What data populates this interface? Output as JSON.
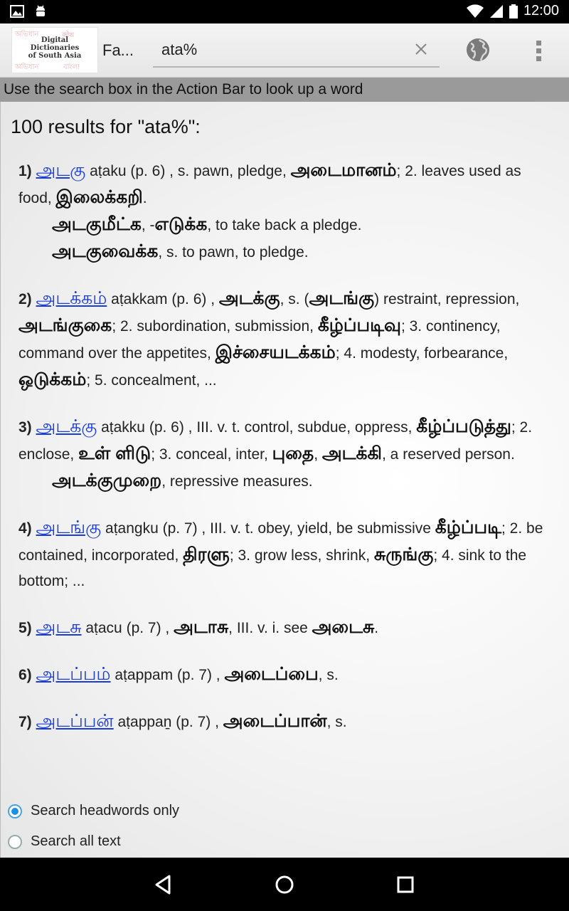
{
  "status_bar": {
    "time": "12:00",
    "icons": [
      "image-icon",
      "android-icon",
      "wifi-icon",
      "signal-icon",
      "battery-icon"
    ]
  },
  "action_bar": {
    "logo_lines": [
      "Digital",
      "Dictionaries",
      "of South Asia"
    ],
    "logo_script_text": [
      "অভিধান",
      "कोश",
      "অভিধান",
      "বাংলা"
    ],
    "app_title": "Fa...",
    "search_value": "ata%",
    "icons": [
      "close-icon",
      "globe-icon",
      "overflow-menu-icon"
    ]
  },
  "hint": "Use the search box in the Action Bar to look up a word",
  "results_title": "100 results for \"ata%\":",
  "entries": {
    "e1": {
      "num": "1)",
      "head": "அடகு",
      "t1": " aṭaku (p. 6) , s. pawn, pledge, ",
      "ta1": "அடைமானம்",
      "t2": "; 2. leaves used as food, ",
      "ta2": "இலைக்கறி",
      "t3": ".",
      "s1_ta": "அடகுமீட்க",
      "s1_mid": ", -",
      "s1_ta2": "எடுக்க",
      "s1_t": ", to take back a pledge.",
      "s2_ta": "அடகுவைக்க",
      "s2_t": ", s. to pawn, to pledge."
    },
    "e2": {
      "num": "2)",
      "head": "அடக்கம்",
      "t1": " aṭakkam (p. 6) , ",
      "ta1": "அடக்கு",
      "t2": ", s. (",
      "ta2": "அடங்கு",
      "t3": ") restraint, repression, ",
      "ta3": "அடங்குகை",
      "t4": "; 2. subordination, submission, ",
      "ta4": "கீழ்ப்படிவு",
      "t5": "; 3. continency, command over the appetites, ",
      "ta5": "இச்சையடக்கம்",
      "t6": "; 4. modesty, forbearance, ",
      "ta6": "ஒடுக்கம்",
      "t7": "; 5. concealment, ..."
    },
    "e3": {
      "num": "3)",
      "head": "அடக்கு",
      "t1": " aṭakku (p. 6) , III. v. t. control, subdue, oppress, ",
      "ta1": "கீழ்ப்படுத்து",
      "t2": "; 2. enclose, ",
      "ta2": "உள் ளிடு",
      "t3": "; 3. conceal, inter, ",
      "ta3": "புதை",
      "t4": ", ",
      "ta4": "அடக்கி",
      "t5": ", a reserved person.",
      "s1_ta": "அடக்குமுறை",
      "s1_t": ", repressive measures."
    },
    "e4": {
      "num": "4)",
      "head": "அடங்கு",
      "t1": " aṭangku (p. 7) , III. v. t. obey, yield, be submissive ",
      "ta1": "கீழ்ப்படி",
      "t2": "; 2. be contained, incorporated, ",
      "ta2": "திரளு",
      "t3": "; 3. grow less, shrink, ",
      "ta3": "சுருங்கு",
      "t4": "; 4. sink to the bottom; ..."
    },
    "e5": {
      "num": "5)",
      "head": "அடசு",
      "t1": " aṭacu (p. 7) , ",
      "ta1": "அடாசு",
      "t2": ", III. v. i. see ",
      "ta2": "அடைசு",
      "t3": "."
    },
    "e6": {
      "num": "6)",
      "head": "அடப்பம்",
      "t1": " aṭappam (p. 7) , ",
      "ta1": "அடைப்பை",
      "t2": ", s."
    },
    "e7": {
      "num": "7)",
      "head": "அடப்பன்",
      "t1": " aṭappaṉ (p. 7) , ",
      "ta1": "அடைப்பான்",
      "t2": ", s."
    }
  },
  "search_options": [
    {
      "label": "Search headwords only",
      "selected": true
    },
    {
      "label": "Search all text",
      "selected": false
    }
  ],
  "nav": [
    "back-icon",
    "home-icon",
    "recents-icon"
  ]
}
